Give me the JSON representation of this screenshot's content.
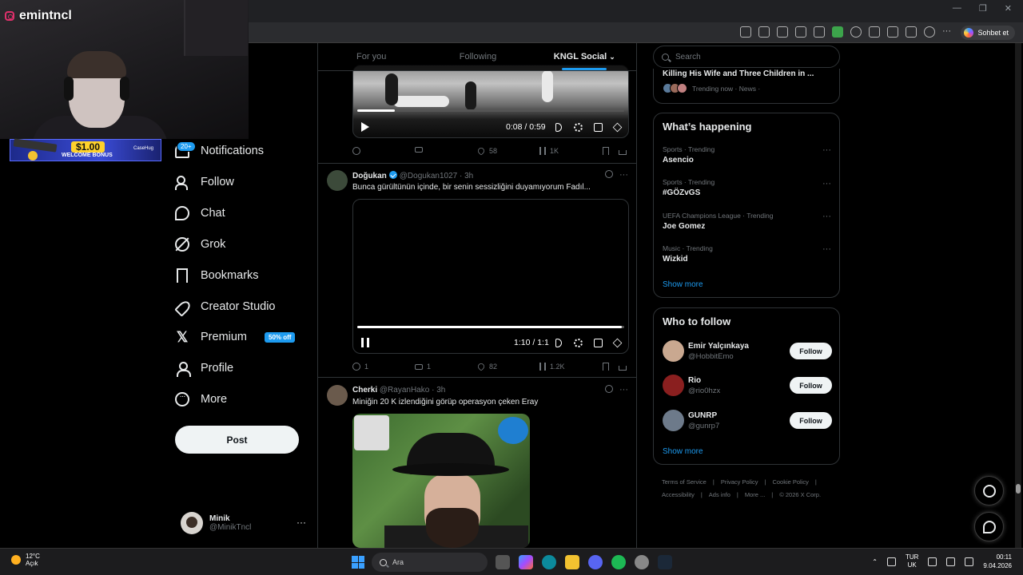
{
  "streamer": {
    "name": "emintncl"
  },
  "banner": {
    "amount": "$1.00",
    "text": "WELCOME BONUS",
    "brand": "CaseHug"
  },
  "browser": {
    "copilot_label": "Sohbet et"
  },
  "nav": {
    "notifications_badge": "20+",
    "items": [
      {
        "label": "Notifications",
        "icon": "bell-icon"
      },
      {
        "label": "Follow",
        "icon": "person-add-icon"
      },
      {
        "label": "Chat",
        "icon": "chat-icon"
      },
      {
        "label": "Grok",
        "icon": "grok-icon"
      },
      {
        "label": "Bookmarks",
        "icon": "bookmark-icon"
      },
      {
        "label": "Creator Studio",
        "icon": "rocket-icon"
      },
      {
        "label": "Premium",
        "icon": "x-logo-icon"
      },
      {
        "label": "Profile",
        "icon": "person-icon"
      },
      {
        "label": "More",
        "icon": "more-circle-icon"
      }
    ],
    "premium_badge": "50% off",
    "post_label": "Post"
  },
  "account": {
    "name": "Minik",
    "handle": "@MinikTncl",
    "more": "···"
  },
  "tabs": [
    {
      "label": "For you",
      "active": false
    },
    {
      "label": "Following",
      "active": false
    },
    {
      "label": "KNGL Social",
      "active": true
    }
  ],
  "posts": [
    {
      "video": {
        "time": "0:08 / 0:59",
        "progress": 0.14,
        "state": "paused"
      },
      "actions": {
        "replies": "",
        "reposts": "",
        "likes": "58",
        "views": "1K"
      }
    },
    {
      "author": "Doğukan",
      "handle": "@Dogukan1027",
      "time": "· 3h",
      "verified": true,
      "text": "Bunca gürültünün içinde, bir senin sessizliğini duyamıyorum Fadıl...",
      "video": {
        "time": "1:10 / 1:1",
        "progress": 0.99,
        "state": "playing"
      },
      "actions": {
        "replies": "1",
        "reposts": "1",
        "likes": "82",
        "views": "1.2K"
      }
    },
    {
      "author": "Cherki",
      "handle": "@RayanHako",
      "time": "· 3h",
      "verified": false,
      "text": "Miniğin 20 K izlendiğini görüp operasyon çeken Eray"
    }
  ],
  "search": {
    "placeholder": "Search"
  },
  "news": {
    "title": "Killing His Wife and Three Children in ...",
    "meta": "Trending now · News ·"
  },
  "happening": {
    "title": "What’s happening",
    "trends": [
      {
        "meta": "Sports · Trending",
        "name": "Asencio"
      },
      {
        "meta": "Sports · Trending",
        "name": "#GÖZvGS"
      },
      {
        "meta": "UEFA Champions League · Trending",
        "name": "Joe Gomez"
      },
      {
        "meta": "Music · Trending",
        "name": "Wizkid"
      }
    ],
    "show_more": "Show more"
  },
  "who_to_follow": {
    "title": "Who to follow",
    "users": [
      {
        "name": "Emir Yalçınkaya",
        "handle": "@HobbitEmo",
        "button": "Follow"
      },
      {
        "name": "Rio",
        "handle": "@rio0hzx",
        "button": "Follow"
      },
      {
        "name": "GUNRP",
        "handle": "@gunrp7",
        "button": "Follow"
      }
    ],
    "show_more": "Show more"
  },
  "footer": {
    "links": [
      "Terms of Service",
      "|",
      "Privacy Policy",
      "|",
      "Cookie Policy",
      "|",
      "Accessibility",
      "|",
      "Ads info",
      "|",
      "More ...",
      "|",
      "© 2026 X Corp."
    ]
  },
  "taskbar": {
    "temp": "12°C",
    "condition": "Açık",
    "search_label": "Ara",
    "lang_top": "TUR",
    "lang_bottom": "UK",
    "time": "00:11",
    "date": "9.04.2026"
  },
  "colors": {
    "accent": "#1d9bf0",
    "background": "#000000",
    "text": "#e7e9ea",
    "muted": "#71767b"
  }
}
